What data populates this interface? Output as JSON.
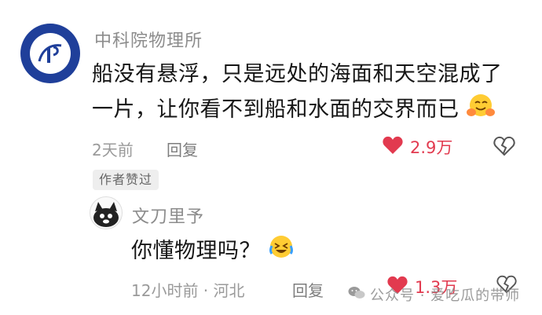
{
  "top_comment": {
    "username": "中科院物理所",
    "text_line1": "船没有悬浮，只是远处的海面和天空混成了",
    "text_line2": "一片，让你看不到船和水面的交界而已",
    "time": "2天前",
    "reply_label": "回复",
    "like_count": "2.9万",
    "avatar_icon": "institute-of-physics-cas-logo",
    "emoji_icon": "hugging-face-emoji"
  },
  "author_badge": "作者赞过",
  "reply": {
    "username": "文刀里予",
    "text": "你懂物理吗？",
    "time_location": "12小时前 · 河北",
    "reply_label": "回复",
    "like_count": "1.3万",
    "emoji_icon": "laughing-crying-emoji"
  },
  "watermark": {
    "text": "公众号 · 爱吃瓜的带师",
    "icon": "wechat-icon"
  },
  "colors": {
    "like": "#e23a4f",
    "avatar_blue": "#1f3f9a",
    "meta_gray": "#9a9a9a"
  }
}
